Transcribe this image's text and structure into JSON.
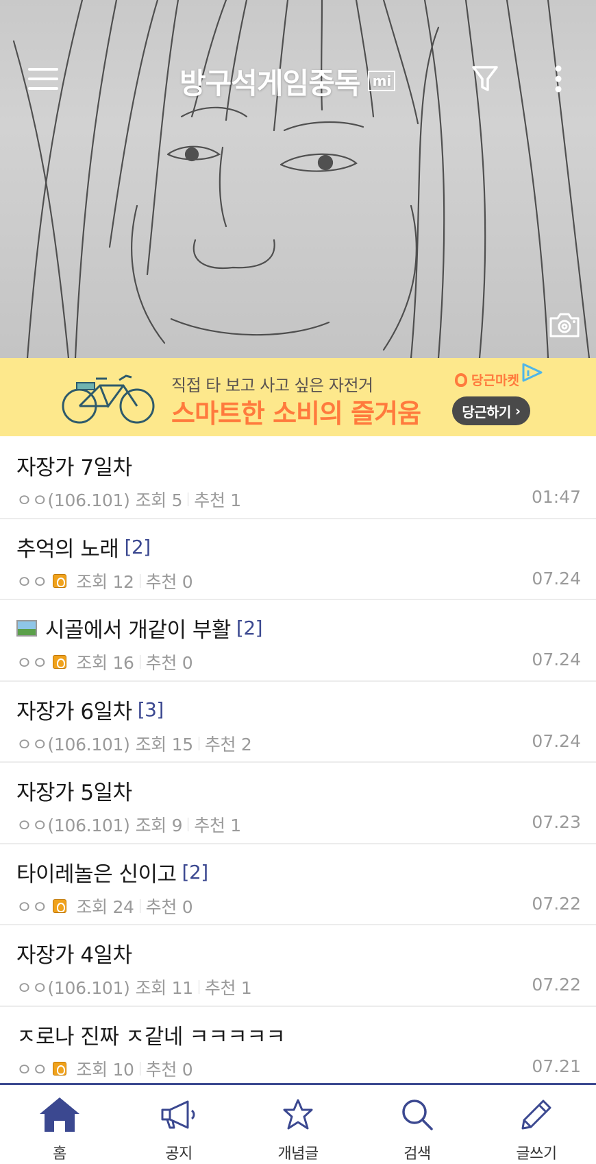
{
  "header": {
    "gallery_title": "방구석게임중독",
    "mini_badge": "mi",
    "icons": [
      "hamburger-menu-icon",
      "filter-icon",
      "more-vertical-icon",
      "camera-icon"
    ]
  },
  "ad": {
    "sub_text": "직접 타 보고 사고 싶은 자전거",
    "main_text": "스마트한 소비의 즐거움",
    "brand": "당근마켓",
    "cta": "당근하기",
    "cta_arrow": "›",
    "colors": {
      "background": "#fde88c",
      "accent": "#ff7a3d"
    }
  },
  "posts": [
    {
      "title": "자장가 7일차",
      "image": false,
      "replies": "",
      "author": "ㅇㅇ(106.101)",
      "fixed_user": false,
      "views": "조회 5",
      "recommends": "추천 1",
      "date": "01:47"
    },
    {
      "title": "추억의 노래",
      "image": false,
      "replies": "[2]",
      "author": "ㅇㅇ",
      "fixed_user": true,
      "views": "조회 12",
      "recommends": "추천 0",
      "date": "07.24"
    },
    {
      "title": "시골에서 개같이 부활",
      "image": true,
      "replies": "[2]",
      "author": "ㅇㅇ",
      "fixed_user": true,
      "views": "조회 16",
      "recommends": "추천 0",
      "date": "07.24"
    },
    {
      "title": "자장가 6일차",
      "image": false,
      "replies": "[3]",
      "author": "ㅇㅇ(106.101)",
      "fixed_user": false,
      "views": "조회 15",
      "recommends": "추천 2",
      "date": "07.24"
    },
    {
      "title": "자장가 5일차",
      "image": false,
      "replies": "",
      "author": "ㅇㅇ(106.101)",
      "fixed_user": false,
      "views": "조회 9",
      "recommends": "추천 1",
      "date": "07.23"
    },
    {
      "title": "타이레놀은 신이고",
      "image": false,
      "replies": "[2]",
      "author": "ㅇㅇ",
      "fixed_user": true,
      "views": "조회 24",
      "recommends": "추천 0",
      "date": "07.22"
    },
    {
      "title": "자장가 4일차",
      "image": false,
      "replies": "",
      "author": "ㅇㅇ(106.101)",
      "fixed_user": false,
      "views": "조회 11",
      "recommends": "추천 1",
      "date": "07.22"
    },
    {
      "title": "ㅈ로나 진짜 ㅈ같네 ㅋㅋㅋㅋㅋ",
      "image": false,
      "replies": "",
      "author": "ㅇㅇ",
      "fixed_user": true,
      "views": "조회 10",
      "recommends": "추천 0",
      "date": "07.21"
    }
  ],
  "bottom_nav": [
    {
      "label": "홈",
      "icon": "home-icon",
      "active": true
    },
    {
      "label": "공지",
      "icon": "megaphone-icon",
      "active": false
    },
    {
      "label": "개념글",
      "icon": "star-icon",
      "active": false
    },
    {
      "label": "검색",
      "icon": "search-icon",
      "active": false
    },
    {
      "label": "글쓰기",
      "icon": "pencil-icon",
      "active": false
    }
  ],
  "colors": {
    "brand": "#3b4890",
    "reply": "#3b4890",
    "meta": "#9a9a9a"
  }
}
